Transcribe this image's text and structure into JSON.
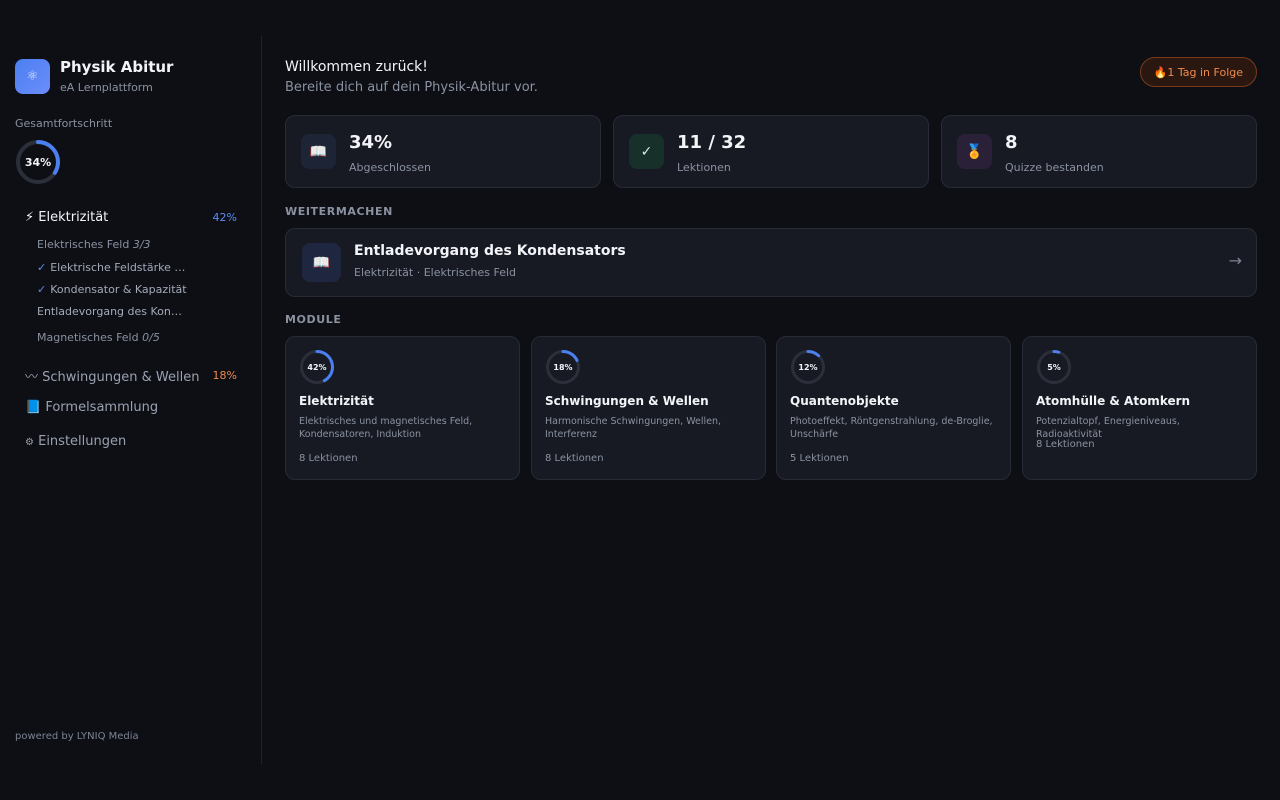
{
  "brand": {
    "title": "Physik Abitur",
    "subtitle": "eA Lernplattform",
    "icon": "atom-icon"
  },
  "sidebar": {
    "progress_label": "Gesamtfortschritt",
    "progress_percent": 34,
    "progress_text": "34%",
    "modules": [
      {
        "icon": "⚡",
        "label": "Elektrizität",
        "percent_text": "42%",
        "color": "#5b8cf5",
        "active": true
      },
      {
        "icon": "〰",
        "label": "Schwingungen & Wellen",
        "percent_text": "18%",
        "color": "#f08a4b",
        "active": false
      },
      {
        "icon": "📘",
        "label": "Formelsammlung",
        "percent_text": "",
        "active": false
      },
      {
        "icon": "⚙",
        "label": "Einstellungen",
        "percent_text": "",
        "active": false
      }
    ],
    "groups": [
      {
        "label": "Elektrisches Feld",
        "count": "3/3"
      },
      {
        "label": "Magnetisches Feld",
        "count": "0/5"
      }
    ],
    "lessons": [
      {
        "check": "✓",
        "label": "Elektrische Feldstärke & Feldlinien"
      },
      {
        "check": "✓",
        "label": "Kondensator & Kapazität"
      },
      {
        "check": "",
        "label": "Entladevorgang des Kondensators"
      }
    ],
    "powered": "powered by LYNIQ Media"
  },
  "header": {
    "welcome": "Willkommen zurück!",
    "subtitle": "Bereite dich auf dein Physik-Abitur vor.",
    "streak_icon": "🔥",
    "streak": "1 Tag in Folge"
  },
  "stats": [
    {
      "icon": "📖",
      "value": "34%",
      "label": "Abgeschlossen",
      "bg": "#1d2435"
    },
    {
      "icon": "✓",
      "value": "11 / 32",
      "label": "Lektionen",
      "bg": "#17302a"
    },
    {
      "icon": "🏅",
      "value": "8",
      "label": "Quizze bestanden",
      "bg": "#2a2138"
    }
  ],
  "continue": {
    "section": "WEITERMACHEN",
    "icon": "📖",
    "title": "Entladevorgang des Kondensators",
    "subtitle": "Elektrizität · Elektrisches Feld",
    "arrow": "→"
  },
  "modules": {
    "section": "MODULE",
    "items": [
      {
        "percent": 42,
        "percent_text": "42%",
        "name": "Elektrizität",
        "desc": "Elektrisches und magnetisches Feld, Kondensatoren, Induktion",
        "count": "8 Lektionen"
      },
      {
        "percent": 18,
        "percent_text": "18%",
        "name": "Schwingungen & Wellen",
        "desc": "Harmonische Schwingungen, Wellen, Interferenz",
        "count": "8 Lektionen"
      },
      {
        "percent": 12,
        "percent_text": "12%",
        "name": "Quantenobjekte",
        "desc": "Photoeffekt, Röntgenstrahlung, de-Broglie, Unschärfe",
        "count": "5 Lektionen"
      },
      {
        "percent": 5,
        "percent_text": "5%",
        "name": "Atomhülle & Atomkern",
        "desc": "Potenzialtopf, Energieniveaus, Radioaktivität",
        "count": "8 Lektionen"
      }
    ],
    "ring_color": "#4c7ff0",
    "ring_track": "#2a2f3a"
  }
}
